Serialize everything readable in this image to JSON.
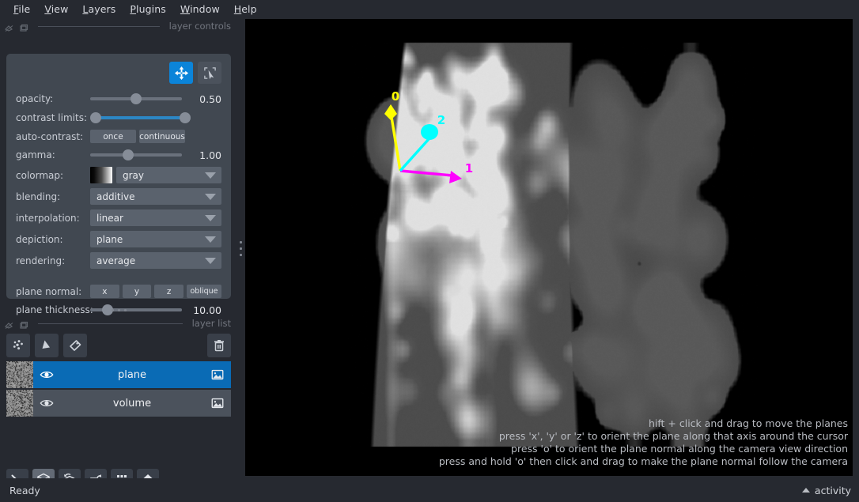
{
  "menubar": {
    "items": [
      {
        "label": "File",
        "mnemonic": "F"
      },
      {
        "label": "View",
        "mnemonic": "V"
      },
      {
        "label": "Layers",
        "mnemonic": "L"
      },
      {
        "label": "Plugins",
        "mnemonic": "P"
      },
      {
        "label": "Window",
        "mnemonic": "W"
      },
      {
        "label": "Help",
        "mnemonic": "H"
      }
    ]
  },
  "docks": {
    "layer_controls_title": "layer controls",
    "layer_list_title": "layer list"
  },
  "layer_controls": {
    "modes": [
      {
        "name": "pan-zoom",
        "active": true
      },
      {
        "name": "transform",
        "active": false
      }
    ],
    "opacity": {
      "label": "opacity:",
      "value": "0.50",
      "fraction": 0.5
    },
    "contrast_limits": {
      "label": "contrast limits:",
      "low": 0.0,
      "high": 1.0
    },
    "auto_contrast": {
      "label": "auto-contrast:",
      "once": "once",
      "continuous": "continuous"
    },
    "gamma": {
      "label": "gamma:",
      "value": "1.00",
      "fraction": 0.41
    },
    "colormap": {
      "label": "colormap:",
      "value": "gray"
    },
    "blending": {
      "label": "blending:",
      "value": "additive"
    },
    "interpolation": {
      "label": "interpolation:",
      "value": "linear"
    },
    "depiction": {
      "label": "depiction:",
      "value": "plane"
    },
    "rendering": {
      "label": "rendering:",
      "value": "average"
    },
    "plane_normal": {
      "label": "plane normal:",
      "x": "x",
      "y": "y",
      "z": "z",
      "oblique": "oblique"
    },
    "plane_thickness": {
      "label": "plane thickness:",
      "value": "10.00",
      "fraction": 0.19
    }
  },
  "layer_buttons": [
    {
      "name": "new-points",
      "tooltip": "New points layer"
    },
    {
      "name": "new-shapes",
      "tooltip": "New shapes layer"
    },
    {
      "name": "new-labels",
      "tooltip": "New labels layer"
    },
    {
      "name": "delete-layer",
      "tooltip": "Delete selected layers"
    }
  ],
  "layers": [
    {
      "name": "plane",
      "visible": true,
      "selected": true,
      "type": "image"
    },
    {
      "name": "volume",
      "visible": true,
      "selected": false,
      "type": "image"
    }
  ],
  "viewer_buttons": [
    {
      "name": "console",
      "active": false
    },
    {
      "name": "ndisplay-toggle",
      "active": true
    },
    {
      "name": "roll-dims",
      "active": false
    },
    {
      "name": "transpose-dims",
      "active": false
    },
    {
      "name": "grid-view",
      "active": false
    },
    {
      "name": "home",
      "active": false
    }
  ],
  "canvas": {
    "axes": [
      {
        "label": "0",
        "color": "#ffff00"
      },
      {
        "label": "1",
        "color": "#ff00ff"
      },
      {
        "label": "2",
        "color": "#00ffff"
      }
    ],
    "help_lines": [
      "hift + click and drag to move the planes",
      "press 'x', 'y' or 'z' to orient the plane along that axis around the cursor",
      "press 'o' to orient the plane normal along the camera view direction",
      "press and hold 'o' then click and drag to make the plane normal follow the camera"
    ]
  },
  "statusbar": {
    "status": "Ready",
    "activity": "activity"
  },
  "colors": {
    "window_bg": "#262930",
    "panel_bg": "#414851",
    "control_bg": "#5a626d",
    "accent": "#0b84d9",
    "selected_row": "#0a6bb5",
    "text": "#d6d8de",
    "muted_text": "#72767f"
  }
}
